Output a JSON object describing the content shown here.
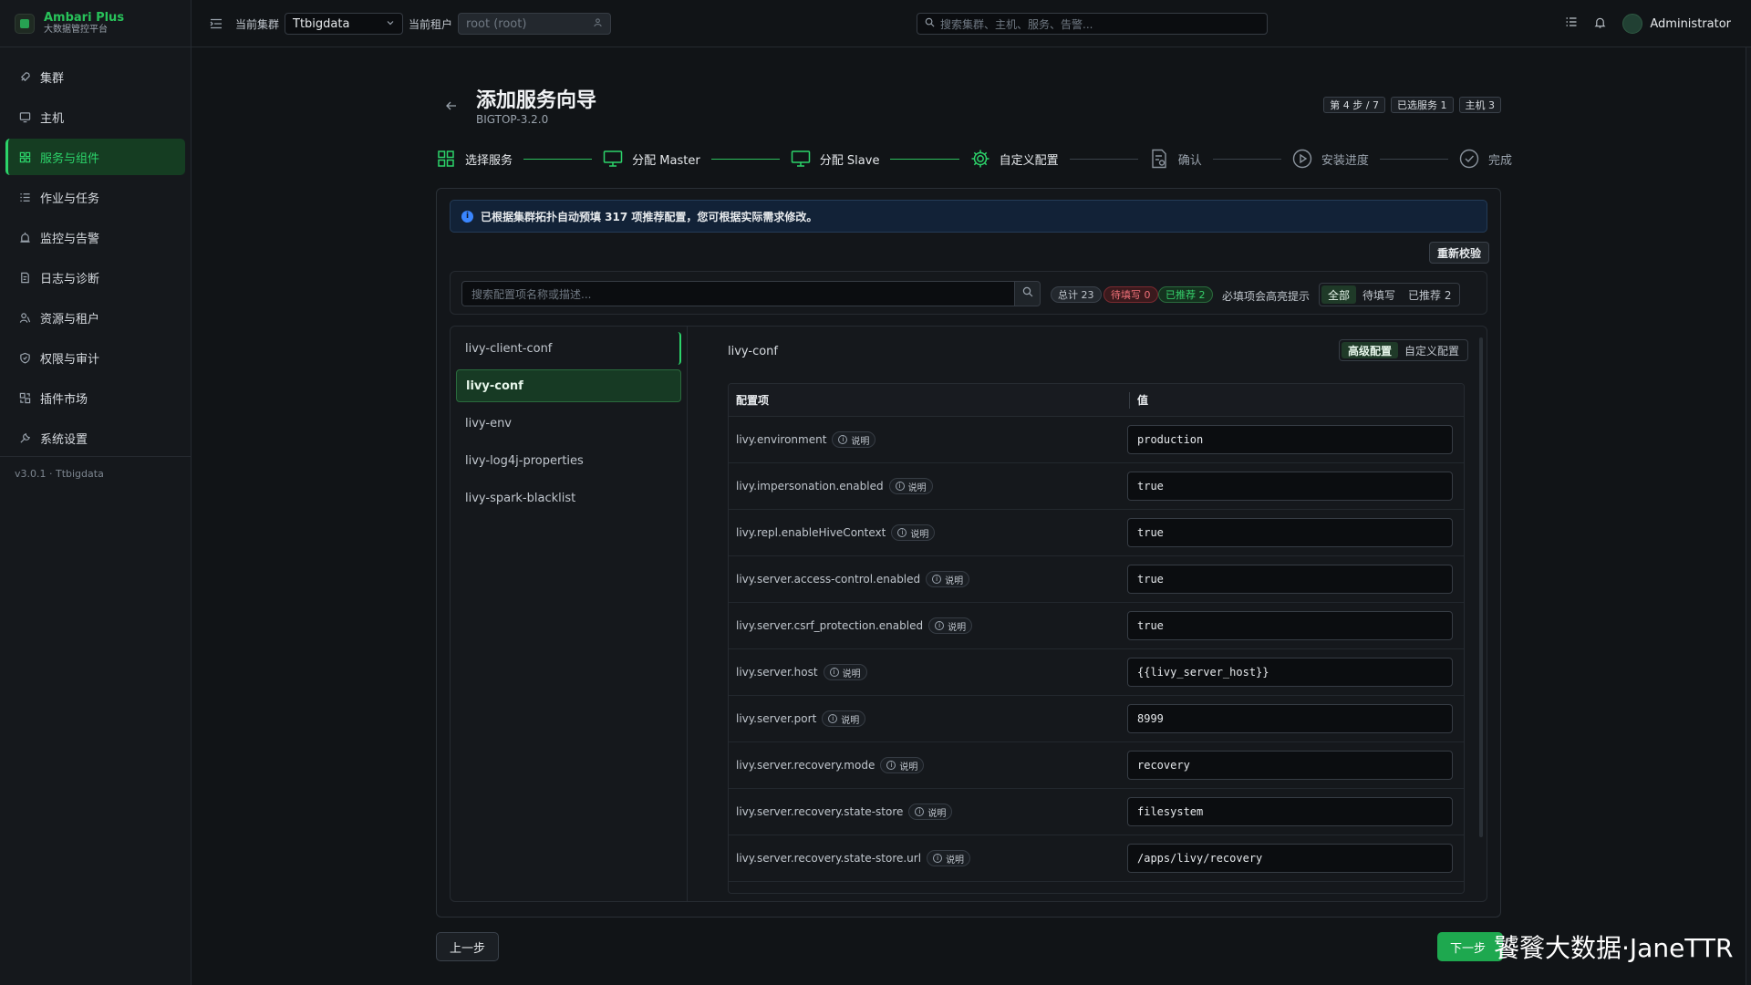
{
  "brand": {
    "name": "Ambari Plus",
    "subtitle": "大数据管控平台"
  },
  "sidebar": {
    "items": [
      {
        "label": "集群",
        "icon": "rocket-icon"
      },
      {
        "label": "主机",
        "icon": "monitor-icon"
      },
      {
        "label": "服务与组件",
        "icon": "grid-icon",
        "active": true
      },
      {
        "label": "作业与任务",
        "icon": "list-icon"
      },
      {
        "label": "监控与告警",
        "icon": "alarm-icon"
      },
      {
        "label": "日志与诊断",
        "icon": "log-icon"
      },
      {
        "label": "资源与租户",
        "icon": "users-icon"
      },
      {
        "label": "权限与审计",
        "icon": "shield-icon"
      },
      {
        "label": "插件市场",
        "icon": "plugin-icon"
      },
      {
        "label": "系统设置",
        "icon": "wrench-icon"
      }
    ],
    "version": "v3.0.1 · Ttbigdata"
  },
  "topbar": {
    "cluster_label": "当前集群",
    "cluster_value": "Ttbigdata",
    "tenant_label": "当前租户",
    "tenant_value": "root (root)",
    "search_placeholder": "搜索集群、主机、服务、告警...",
    "user": "Administrator"
  },
  "page": {
    "title": "添加服务向导",
    "subtitle": "BIGTOP-3.2.0",
    "badges": [
      "第 4 步 / 7",
      "已选服务 1",
      "主机 3"
    ]
  },
  "steps": [
    {
      "label": "选择服务",
      "status": "done"
    },
    {
      "label": "分配 Master",
      "status": "done"
    },
    {
      "label": "分配 Slave",
      "status": "done"
    },
    {
      "label": "自定义配置",
      "status": "current"
    },
    {
      "label": "确认",
      "status": "pending"
    },
    {
      "label": "安装进度",
      "status": "pending"
    },
    {
      "label": "完成",
      "status": "pending"
    }
  ],
  "info_text": "已根据集群拓扑自动预填 317 项推荐配置，您可根据实际需求修改。",
  "revalidate_label": "重新校验",
  "filter": {
    "placeholder": "搜索配置项名称或描述...",
    "total": "总计 23",
    "todo": "待填写 0",
    "recommended": "已推荐 2",
    "hint": "必填项会高亮提示",
    "seg": [
      "全部",
      "待填写",
      "已推荐 2"
    ]
  },
  "config_groups": [
    "livy-client-conf",
    "livy-conf",
    "livy-env",
    "livy-log4j-properties",
    "livy-spark-blacklist"
  ],
  "panel": {
    "title": "livy-conf",
    "tabs": [
      "高级配置",
      "自定义配置"
    ],
    "col_key": "配置项",
    "col_value": "值",
    "help_label": "说明",
    "rows": [
      {
        "key": "livy.environment",
        "value": "production"
      },
      {
        "key": "livy.impersonation.enabled",
        "value": "true"
      },
      {
        "key": "livy.repl.enableHiveContext",
        "value": "true"
      },
      {
        "key": "livy.server.access-control.enabled",
        "value": "true"
      },
      {
        "key": "livy.server.csrf_protection.enabled",
        "value": "true"
      },
      {
        "key": "livy.server.host",
        "value": "{{livy_server_host}}"
      },
      {
        "key": "livy.server.port",
        "value": "8999"
      },
      {
        "key": "livy.server.recovery.mode",
        "value": "recovery"
      },
      {
        "key": "livy.server.recovery.state-store",
        "value": "filesystem"
      },
      {
        "key": "livy.server.recovery.state-store.url",
        "value": "/apps/livy/recovery"
      }
    ]
  },
  "footer": {
    "prev": "上一步",
    "next": "下一步"
  },
  "watermark": "饕餮大数据·JaneTTR",
  "colors": {
    "accent": "#2cd36a",
    "danger": "#f07179",
    "info": "#3a86ff"
  }
}
